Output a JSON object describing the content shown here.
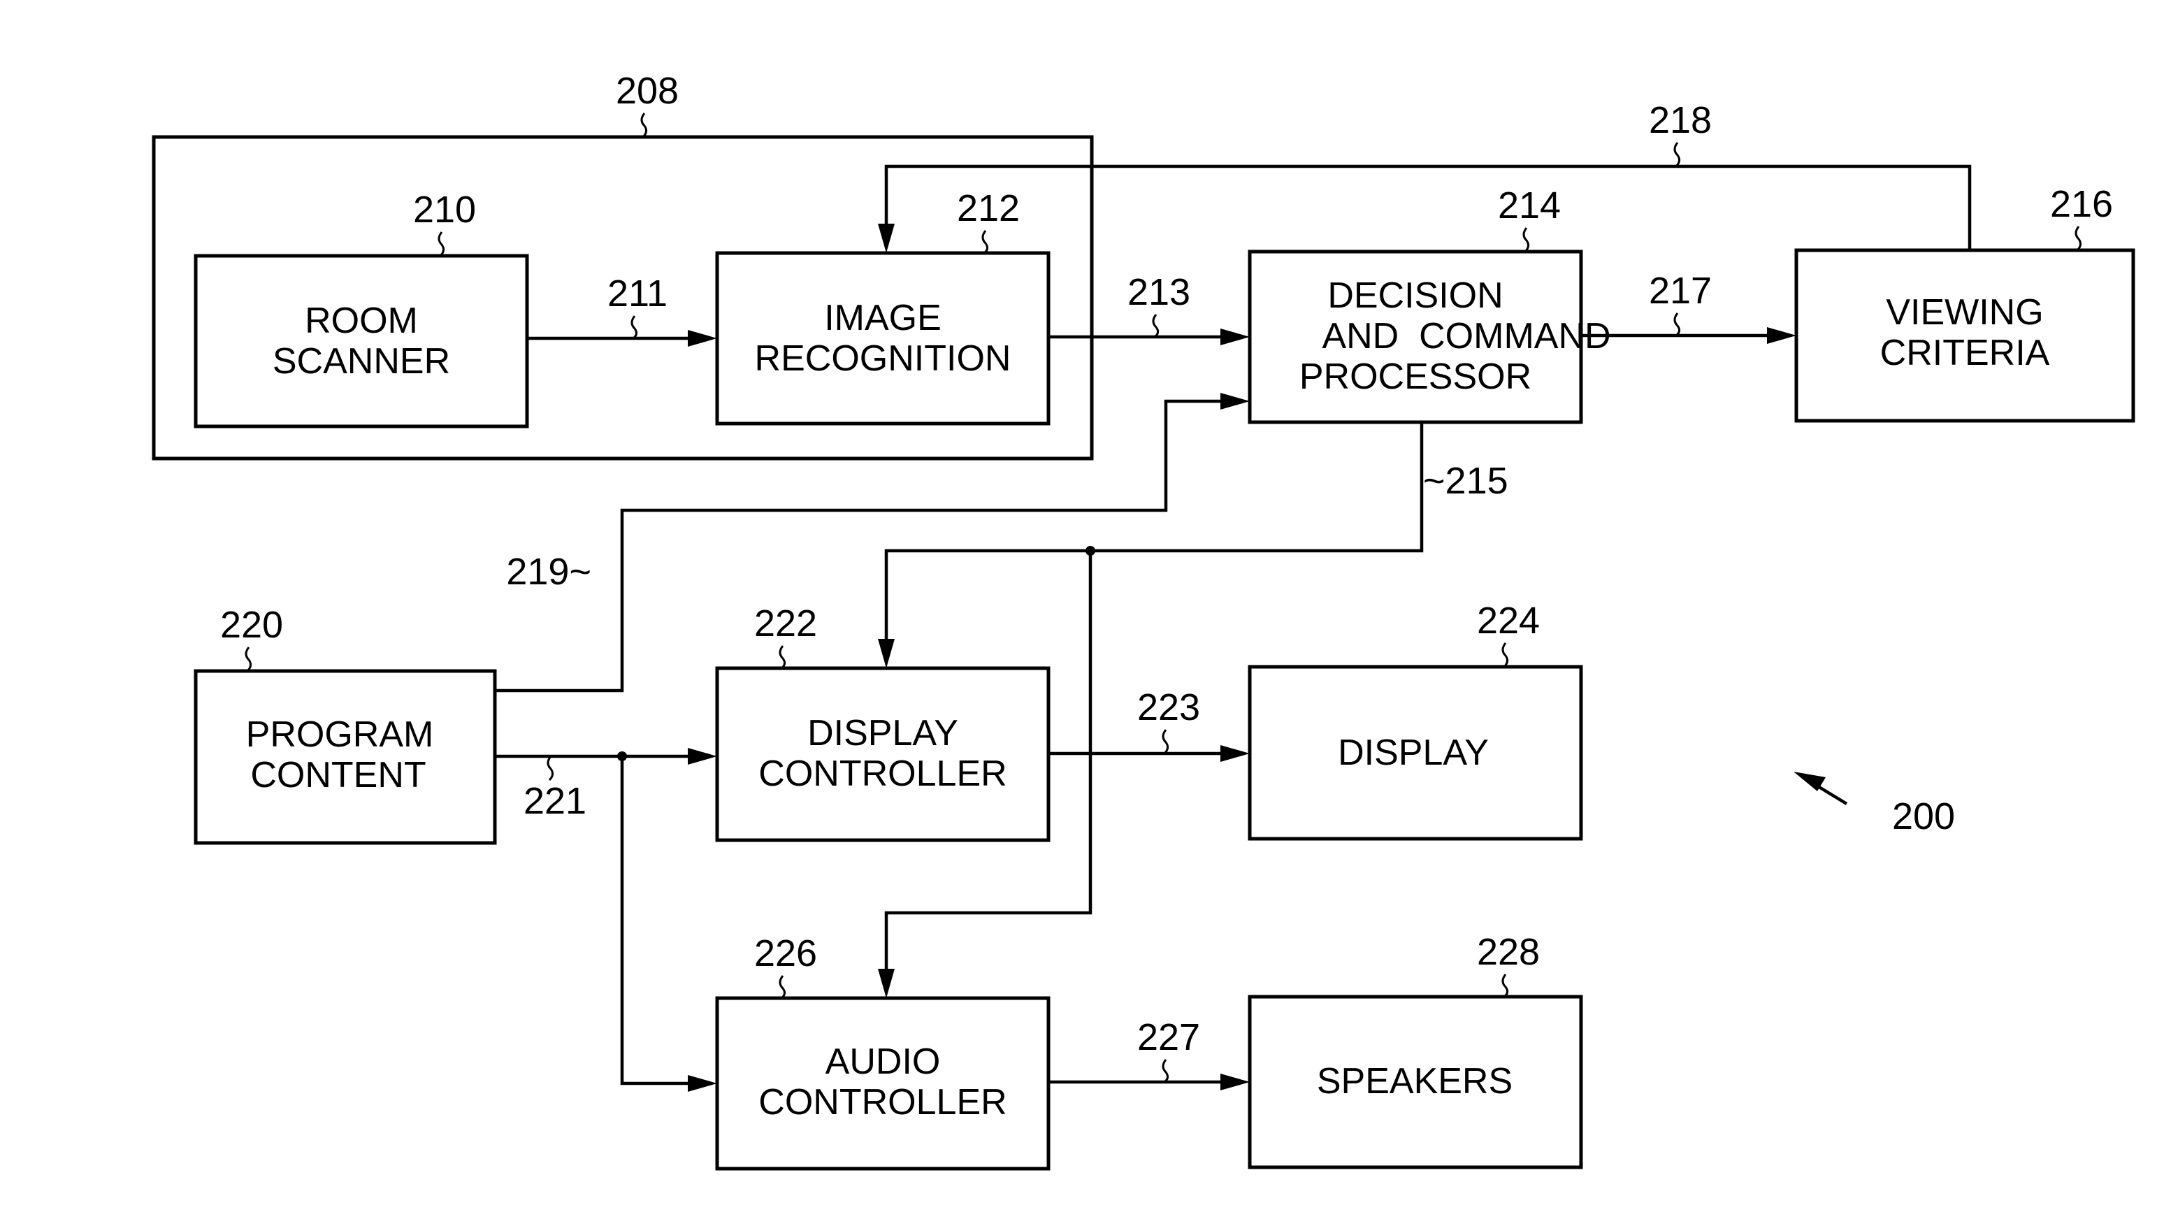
{
  "figure": {
    "ref": "200",
    "group": {
      "ref": "208"
    }
  },
  "blocks": {
    "room_scanner": {
      "ref": "210",
      "lines": [
        "ROOM",
        "SCANNER"
      ]
    },
    "image_recognition": {
      "ref": "212",
      "lines": [
        "IMAGE",
        "RECOGNITION"
      ]
    },
    "decision_processor": {
      "ref": "214",
      "lines": [
        "DECISION",
        "AND  COMMAND",
        "PROCESSOR"
      ]
    },
    "viewing_criteria": {
      "ref": "216",
      "lines": [
        "VIEWING",
        "CRITERIA"
      ]
    },
    "program_content": {
      "ref": "220",
      "lines": [
        "PROGRAM",
        "CONTENT"
      ]
    },
    "display_controller": {
      "ref": "222",
      "lines": [
        "DISPLAY",
        "CONTROLLER"
      ]
    },
    "display": {
      "ref": "224",
      "lines": [
        "DISPLAY"
      ]
    },
    "audio_controller": {
      "ref": "226",
      "lines": [
        "AUDIO",
        "CONTROLLER"
      ]
    },
    "speakers": {
      "ref": "228",
      "lines": [
        "SPEAKERS"
      ]
    }
  },
  "connections": {
    "c211": {
      "ref": "211",
      "from": "ROOM SCANNER",
      "to": "IMAGE RECOGNITION"
    },
    "c213": {
      "ref": "213",
      "from": "IMAGE RECOGNITION",
      "to": "DECISION AND COMMAND PROCESSOR"
    },
    "c215": {
      "ref": "~215",
      "from": "DECISION AND COMMAND PROCESSOR",
      "to": "DISPLAY CONTROLLER, AUDIO CONTROLLER"
    },
    "c217": {
      "ref": "217",
      "from": "DECISION AND COMMAND PROCESSOR",
      "to": "VIEWING CRITERIA"
    },
    "c218": {
      "ref": "218",
      "from": "VIEWING CRITERIA",
      "to": "IMAGE RECOGNITION"
    },
    "c219": {
      "ref": "219~",
      "from": "PROGRAM CONTENT",
      "to": "DECISION AND COMMAND PROCESSOR"
    },
    "c221": {
      "ref": "221",
      "from": "PROGRAM CONTENT",
      "to": "DISPLAY CONTROLLER, AUDIO CONTROLLER"
    },
    "c223": {
      "ref": "223",
      "from": "DISPLAY CONTROLLER",
      "to": "DISPLAY"
    },
    "c227": {
      "ref": "227",
      "from": "AUDIO CONTROLLER",
      "to": "SPEAKERS"
    }
  }
}
